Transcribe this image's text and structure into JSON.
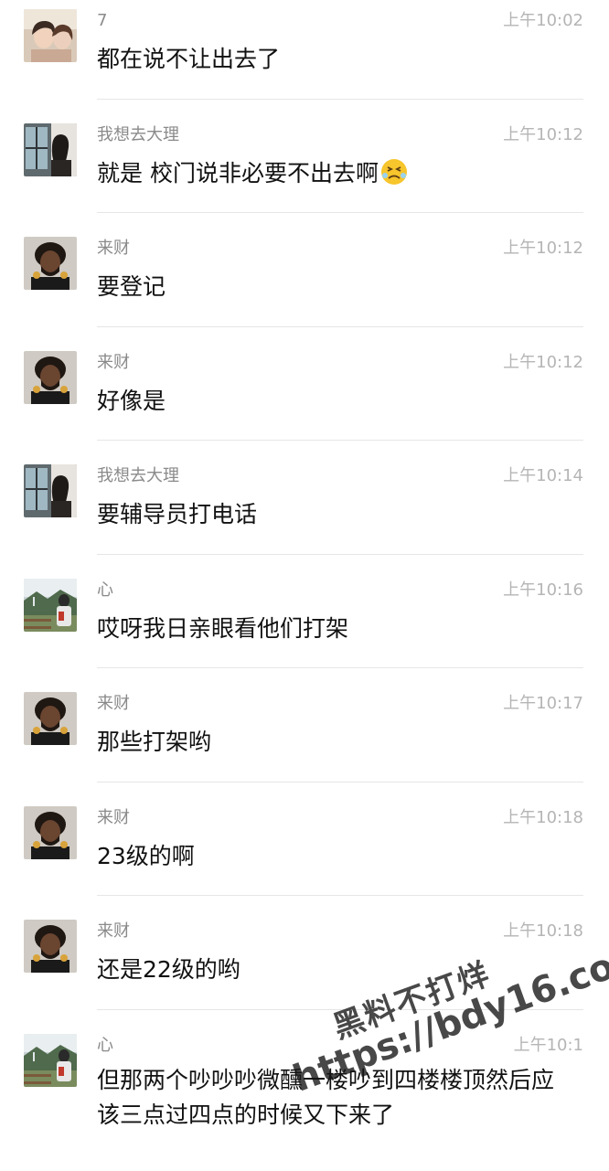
{
  "messages": [
    {
      "sender": "7",
      "time": "上午10:02",
      "text": "都在说不让出去了",
      "avatar": "girl-selfie-avatar"
    },
    {
      "sender": "我想去大理",
      "time": "上午10:12",
      "text": "就是 校门说非必要不出去啊",
      "emoji": "persevering-face-emoji",
      "avatar": "girl-window-avatar"
    },
    {
      "sender": "来财",
      "time": "上午10:12",
      "text": "要登记",
      "avatar": "man-avatar"
    },
    {
      "sender": "来财",
      "time": "上午10:12",
      "text": "好像是",
      "avatar": "man-avatar"
    },
    {
      "sender": "我想去大理",
      "time": "上午10:14",
      "text": "要辅导员打电话",
      "avatar": "girl-window-avatar"
    },
    {
      "sender": "心",
      "time": "上午10:16",
      "text": "哎呀我日亲眼看他们打架",
      "avatar": "hiker-avatar"
    },
    {
      "sender": "来财",
      "time": "上午10:17",
      "text": "那些打架哟",
      "avatar": "man-avatar"
    },
    {
      "sender": "来财",
      "time": "上午10:18",
      "text": "23级的啊",
      "avatar": "man-avatar"
    },
    {
      "sender": "来财",
      "time": "上午10:18",
      "text": "还是22级的哟",
      "avatar": "man-avatar"
    },
    {
      "sender": "心",
      "time": "上午10:1",
      "text": "但那两个吵吵吵微醺一楼吵到四楼楼顶然后应该三点过四点的时候又下来了",
      "avatar": "hiker-avatar"
    }
  ],
  "watermark": {
    "line1": "黑料不打烊",
    "line2": "https://bdy16.co"
  }
}
